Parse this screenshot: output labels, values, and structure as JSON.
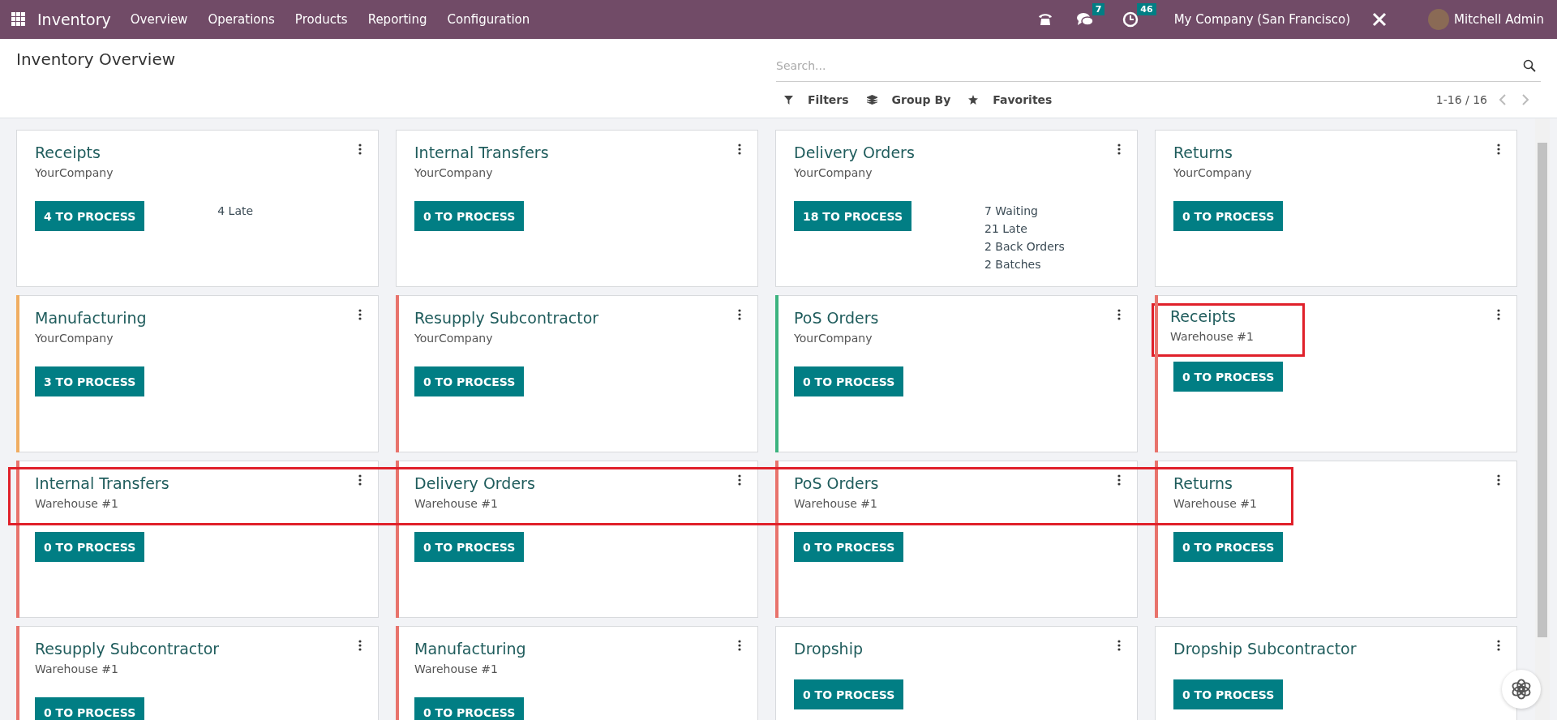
{
  "navbar": {
    "app": "Inventory",
    "menu": [
      "Overview",
      "Operations",
      "Products",
      "Reporting",
      "Configuration"
    ],
    "messages_count": "7",
    "activities_count": "46",
    "company": "My Company (San Francisco)",
    "user": "Mitchell Admin"
  },
  "control_panel": {
    "title": "Inventory Overview",
    "search": {
      "placeholder": "Search..."
    },
    "filters": "Filters",
    "group_by": "Group By",
    "favorites": "Favorites",
    "pager": "1-16 / 16"
  },
  "rows": [
    {
      "highlighted": false,
      "cards": [
        {
          "title": "Receipts",
          "subtitle": "YourCompany",
          "button": "4 TO PROCESS",
          "stats": [
            "4 Late"
          ],
          "highlighted": false
        },
        {
          "title": "Internal Transfers",
          "subtitle": "YourCompany",
          "button": "0 TO PROCESS",
          "highlighted": false
        },
        {
          "title": "Delivery Orders",
          "subtitle": "YourCompany",
          "button": "18 TO PROCESS",
          "stats": [
            "7 Waiting",
            "21 Late",
            "2 Back Orders",
            "2 Batches"
          ],
          "highlighted": false
        },
        {
          "title": "Returns",
          "subtitle": "YourCompany",
          "button": "0 TO PROCESS",
          "highlighted": false
        }
      ]
    },
    {
      "highlighted": false,
      "cards": [
        {
          "title": "Manufacturing",
          "subtitle": "YourCompany",
          "button": "3 TO PROCESS",
          "color": "#f0ad62",
          "highlighted": false
        },
        {
          "title": "Resupply Subcontractor",
          "subtitle": "YourCompany",
          "button": "0 TO PROCESS",
          "color": "#e8736c",
          "highlighted": false
        },
        {
          "title": "PoS Orders",
          "subtitle": "YourCompany",
          "button": "0 TO PROCESS",
          "color": "#3cb37f",
          "highlighted": false
        },
        {
          "title": "Receipts",
          "subtitle": "Warehouse #1",
          "button": "0 TO PROCESS",
          "color": "#e8736c",
          "highlighted": true
        }
      ]
    },
    {
      "highlighted": true,
      "cards": [
        {
          "title": "Internal Transfers",
          "subtitle": "Warehouse #1",
          "button": "0 TO PROCESS",
          "color": "#e8736c",
          "highlighted": false
        },
        {
          "title": "Delivery Orders",
          "subtitle": "Warehouse #1",
          "button": "0 TO PROCESS",
          "color": "#e8736c",
          "highlighted": false
        },
        {
          "title": "PoS Orders",
          "subtitle": "Warehouse #1",
          "button": "0 TO PROCESS",
          "color": "#e8736c",
          "highlighted": false
        },
        {
          "title": "Returns",
          "subtitle": "Warehouse #1",
          "button": "0 TO PROCESS",
          "color": "#e8736c",
          "highlighted": false
        }
      ]
    },
    {
      "highlighted": false,
      "cards": [
        {
          "title": "Resupply Subcontractor",
          "subtitle": "Warehouse #1",
          "button": "0 TO PROCESS",
          "color": "#e8736c",
          "highlighted": false
        },
        {
          "title": "Manufacturing",
          "subtitle": "Warehouse #1",
          "button": "0 TO PROCESS",
          "color": "#e8736c",
          "highlighted": false
        },
        {
          "title": "Dropship",
          "button": "0 TO PROCESS",
          "highlighted": false
        },
        {
          "title": "Dropship Subcontractor",
          "button": "0 TO PROCESS",
          "highlighted": false
        }
      ]
    }
  ]
}
